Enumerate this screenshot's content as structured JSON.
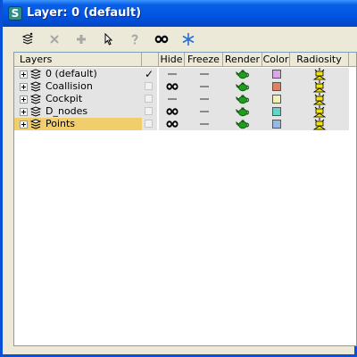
{
  "window": {
    "title": "Layer: 0 (default)",
    "app_icon_glyph": "S",
    "accent": "#0055e5"
  },
  "toolbar": {
    "buttons": [
      {
        "name": "create-layer",
        "icon": "create-new-layer-icon",
        "enabled": true
      },
      {
        "name": "delete-layer",
        "icon": "delete-x-icon",
        "enabled": false
      },
      {
        "name": "add-to-layer",
        "icon": "plus-icon",
        "enabled": false
      },
      {
        "name": "select-objects",
        "icon": "select-arrow-icon",
        "enabled": true
      },
      {
        "name": "highlight-selected",
        "icon": "question-mark-icon",
        "enabled": false
      },
      {
        "name": "hide-unhide-all",
        "icon": "hide-eyes-icon",
        "enabled": true
      },
      {
        "name": "freeze-unfreeze-all",
        "icon": "snowflake-icon",
        "enabled": true
      }
    ]
  },
  "columns": {
    "layers": "Layers",
    "hide": "Hide",
    "freeze": "Freeze",
    "render": "Render",
    "color": "Color",
    "radiosity": "Radiosity"
  },
  "layers": [
    {
      "name": "0 (default)",
      "current": true,
      "hidden": false,
      "frozen": false,
      "render": true,
      "color": "#d9a6e6",
      "radiosity": true,
      "selected": false
    },
    {
      "name": "Coallision",
      "current": false,
      "hidden": true,
      "frozen": false,
      "render": true,
      "color": "#e0805e",
      "radiosity": true,
      "selected": false
    },
    {
      "name": "Cockpit",
      "current": false,
      "hidden": false,
      "frozen": false,
      "render": true,
      "color": "#f1efb1",
      "radiosity": true,
      "selected": false
    },
    {
      "name": "D_nodes",
      "current": false,
      "hidden": true,
      "frozen": false,
      "render": true,
      "color": "#5ed6c6",
      "radiosity": true,
      "selected": false
    },
    {
      "name": "Points",
      "current": false,
      "hidden": true,
      "frozen": false,
      "render": true,
      "color": "#9ab8e6",
      "radiosity": true,
      "selected": true
    }
  ]
}
